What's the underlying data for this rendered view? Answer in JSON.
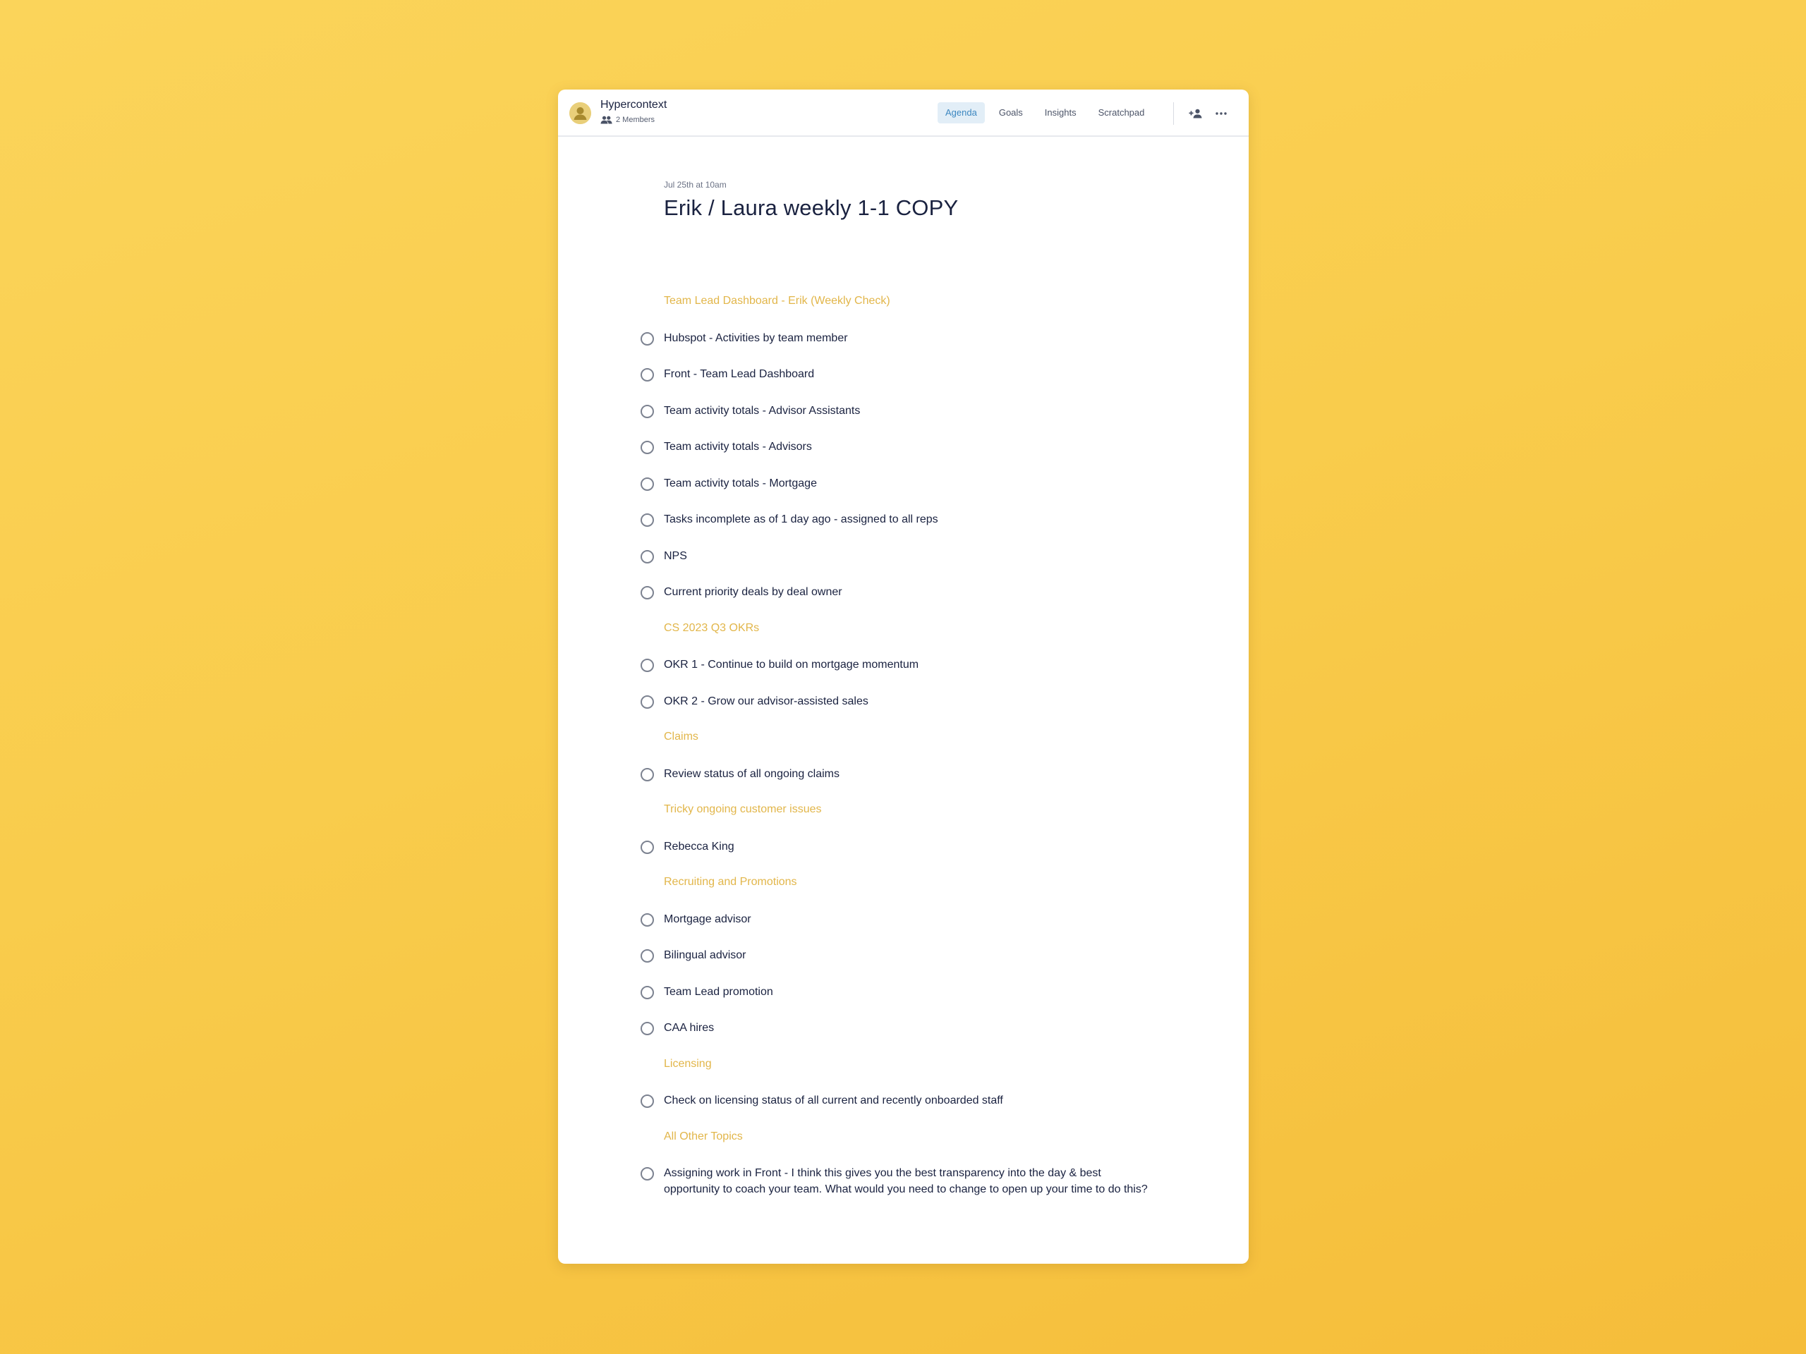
{
  "workspace": {
    "name": "Hypercontext",
    "members": "2 Members"
  },
  "tabs": [
    {
      "label": "Agenda",
      "active": true
    },
    {
      "label": "Goals",
      "active": false
    },
    {
      "label": "Insights",
      "active": false
    },
    {
      "label": "Scratchpad",
      "active": false
    }
  ],
  "actions": {
    "add_member_icon": "person-add-icon",
    "more_icon": "more-horizontal-icon"
  },
  "meeting": {
    "date": "Jul 25th at 10am",
    "title": "Erik / Laura weekly 1-1 COPY"
  },
  "colors": {
    "section_title": "#e2b64a",
    "active_tab_bg": "#e2eef7",
    "active_tab_text": "#3c87c0",
    "text_primary": "#1a2240"
  },
  "agenda": [
    {
      "type": "section",
      "text": "Team Lead Dashboard - Erik (Weekly Check)"
    },
    {
      "type": "item",
      "text": "Hubspot - Activities by team member"
    },
    {
      "type": "item",
      "text": "Front - Team Lead Dashboard"
    },
    {
      "type": "item",
      "text": "Team activity totals - Advisor Assistants"
    },
    {
      "type": "item",
      "text": "Team activity totals - Advisors"
    },
    {
      "type": "item",
      "text": "Team activity totals - Mortgage"
    },
    {
      "type": "item",
      "text": "Tasks incomplete as of 1 day ago - assigned to all reps"
    },
    {
      "type": "item",
      "text": "NPS"
    },
    {
      "type": "item",
      "text": "Current priority deals by deal owner"
    },
    {
      "type": "section",
      "text": "CS 2023 Q3 OKRs"
    },
    {
      "type": "item",
      "text": "OKR 1 - Continue to build on mortgage momentum"
    },
    {
      "type": "item",
      "text": "OKR 2 - Grow our advisor-assisted sales"
    },
    {
      "type": "section",
      "text": "Claims"
    },
    {
      "type": "item",
      "text": "Review status of all ongoing claims"
    },
    {
      "type": "section",
      "text": "Tricky ongoing customer issues"
    },
    {
      "type": "item",
      "text": "Rebecca King"
    },
    {
      "type": "section",
      "text": "Recruiting and Promotions"
    },
    {
      "type": "item",
      "text": "Mortgage advisor"
    },
    {
      "type": "item",
      "text": "Bilingual advisor"
    },
    {
      "type": "item",
      "text": "Team Lead promotion"
    },
    {
      "type": "item",
      "text": "CAA hires"
    },
    {
      "type": "section",
      "text": "Licensing"
    },
    {
      "type": "item",
      "text": "Check on licensing status of all current and recently onboarded staff"
    },
    {
      "type": "section",
      "text": "All Other Topics"
    },
    {
      "type": "item",
      "text": "Assigning work in Front - I think this gives you the best transparency into the day & best opportunity to coach your team. What would you need to change to open up your time to do this?"
    }
  ]
}
